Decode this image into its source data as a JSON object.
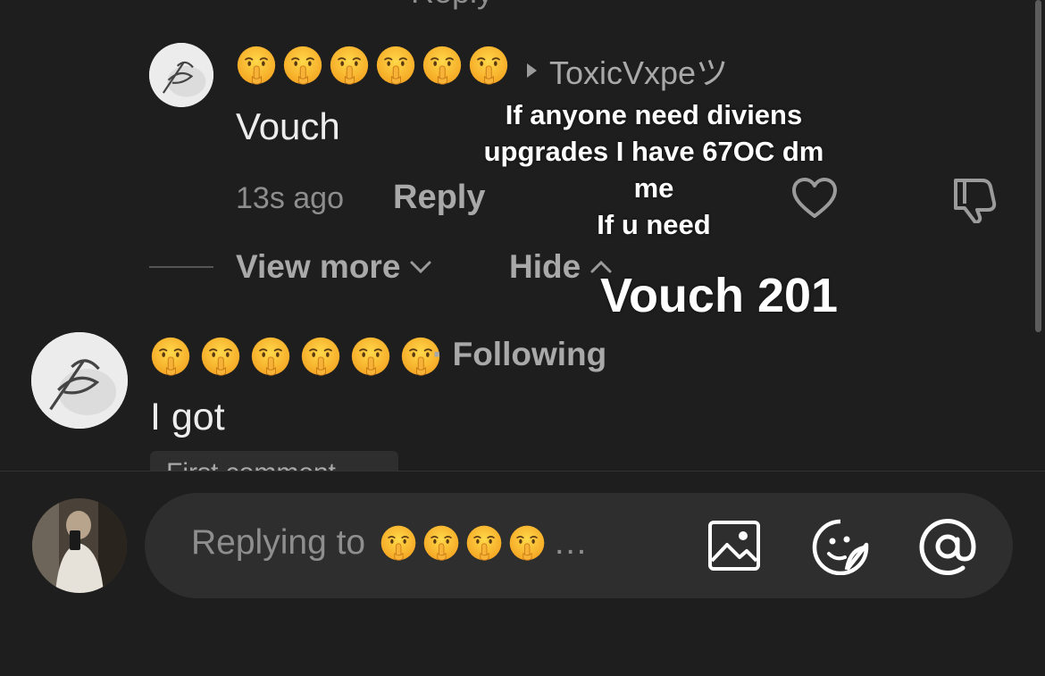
{
  "top_partial": {
    "label": "Reply"
  },
  "reply_comment": {
    "emoji": [
      "🤫",
      "🤫",
      "🤫",
      "🤫",
      "🤫",
      "🤫"
    ],
    "replying_to": "ToxicVxpeツ",
    "text": "Vouch",
    "time": "13s ago",
    "reply_label": "Reply"
  },
  "thread_controls": {
    "view_more": "View more",
    "hide": "Hide"
  },
  "overlay": {
    "line1": "If anyone need diviens",
    "line2": "upgrades I have 67OC dm",
    "line3": "me",
    "line4": "If u need",
    "big": "Vouch 201"
  },
  "main_comment": {
    "emoji": [
      "🤫",
      "🤫",
      "🤫",
      "🤫",
      "🤫",
      "🤫"
    ],
    "following": "· Following",
    "text": "I got",
    "partial_chip": "First comment"
  },
  "composer": {
    "placeholder_prefix": "Replying to",
    "emoji": [
      "🤫",
      "🤫",
      "🤫",
      "🤫"
    ],
    "ellipsis": "…"
  },
  "icons": {
    "heart": "heart-icon",
    "dislike": "thumbs-down-icon",
    "image": "image-icon",
    "sticker": "sticker-icon",
    "mention": "at-icon"
  }
}
